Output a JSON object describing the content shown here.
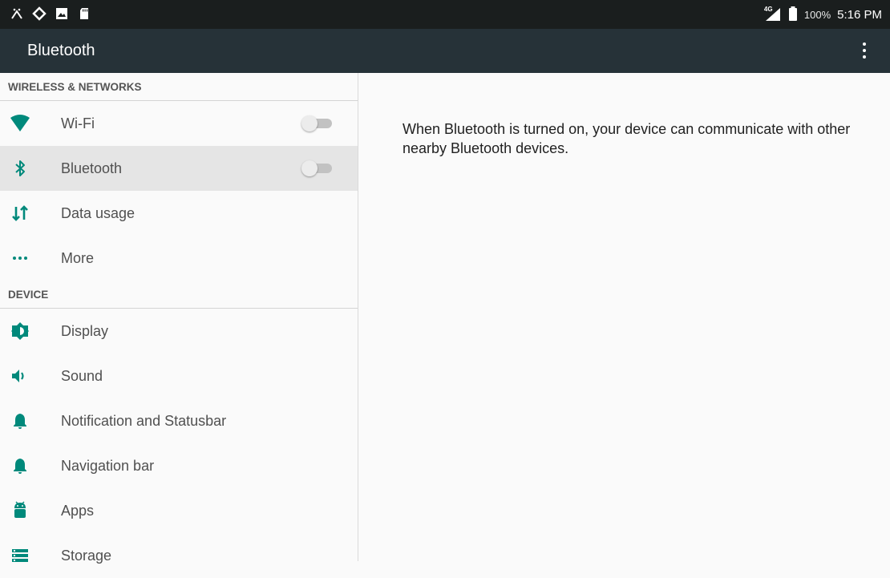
{
  "status_bar": {
    "network": "4G",
    "battery": "100%",
    "time": "5:16 PM"
  },
  "app_bar": {
    "title": "Bluetooth"
  },
  "sections": [
    {
      "header": "WIRELESS & NETWORKS",
      "items": [
        {
          "label": "Wi-Fi",
          "icon": "wifi-icon",
          "toggle": false
        },
        {
          "label": "Bluetooth",
          "icon": "bluetooth-icon",
          "toggle": false,
          "selected": true
        },
        {
          "label": "Data usage",
          "icon": "data-usage-icon"
        },
        {
          "label": "More",
          "icon": "more-dots-icon"
        }
      ]
    },
    {
      "header": "DEVICE",
      "items": [
        {
          "label": "Display",
          "icon": "display-brightness-icon"
        },
        {
          "label": "Sound",
          "icon": "sound-icon"
        },
        {
          "label": "Notification and Statusbar",
          "icon": "bell-icon"
        },
        {
          "label": "Navigation bar",
          "icon": "bell-icon"
        },
        {
          "label": "Apps",
          "icon": "android-icon"
        },
        {
          "label": "Storage",
          "icon": "storage-icon"
        }
      ]
    }
  ],
  "detail": {
    "description": "When Bluetooth is turned on, your device can communicate with other nearby Bluetooth devices."
  },
  "colors": {
    "accent": "#00897b",
    "app_bar": "#263238",
    "status_bar": "#1a1e1e",
    "selected_row": "#e5e5e5"
  }
}
